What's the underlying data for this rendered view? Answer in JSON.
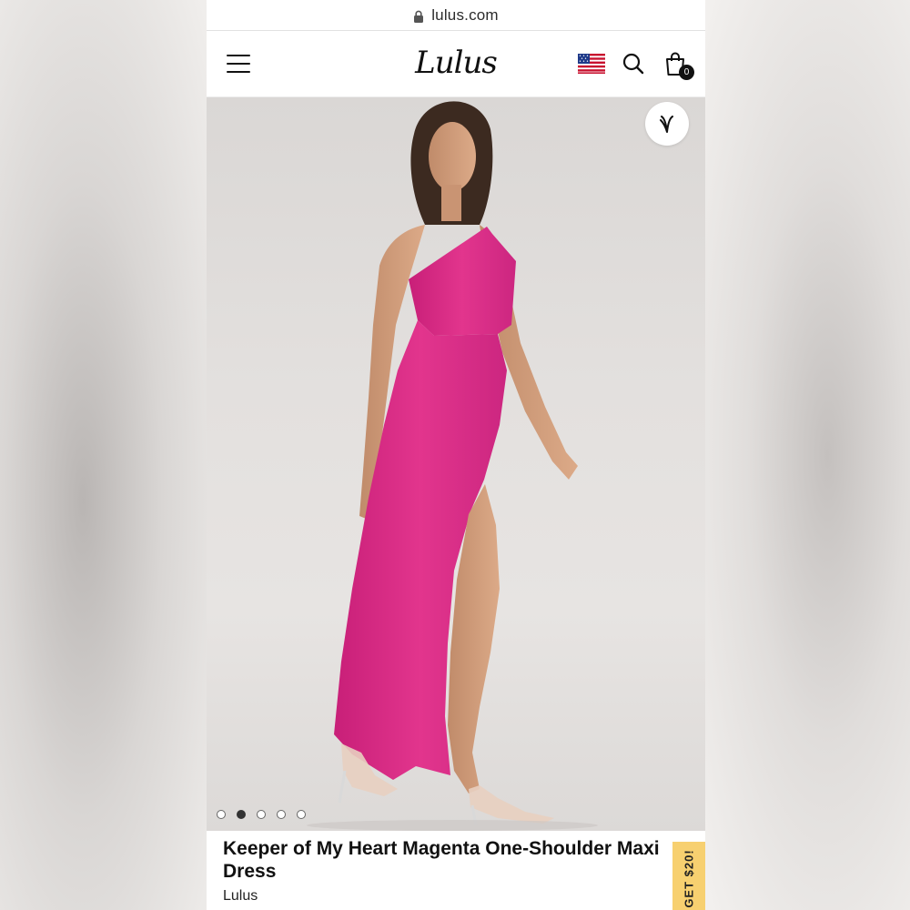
{
  "browser": {
    "url": "lulus.com"
  },
  "header": {
    "logo": "Lulus",
    "cart_count": "0"
  },
  "product": {
    "title": "Keeper of My Heart Magenta One-Shoulder Maxi Dress",
    "brand": "Lulus",
    "dress_color": "#e2358d",
    "image_count": 5,
    "active_image": 2
  },
  "promo": {
    "label": "GET $20!"
  },
  "colors": {
    "accent": "#f7d070",
    "text": "#111111"
  }
}
